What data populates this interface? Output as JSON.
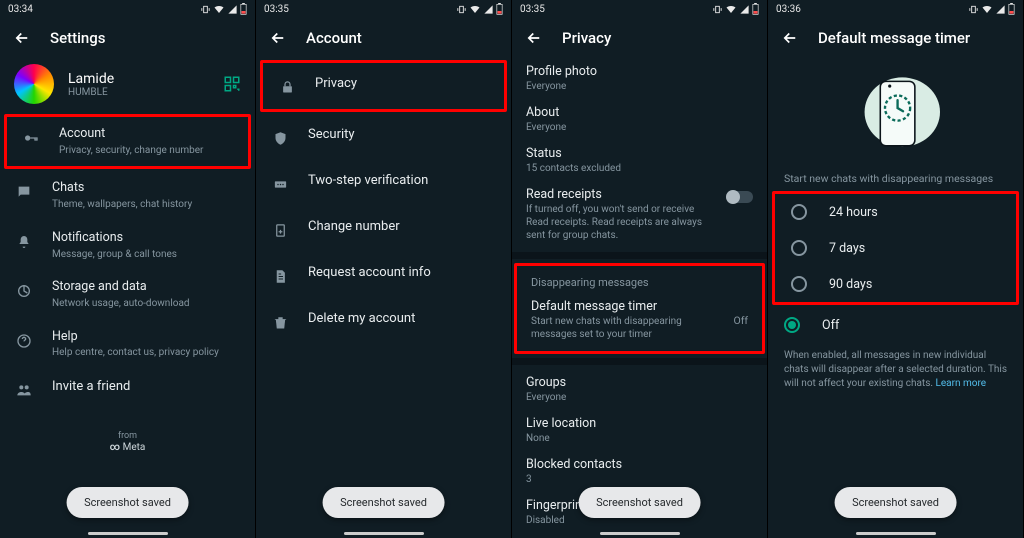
{
  "status": {
    "times": [
      "03:34",
      "03:35",
      "03:35",
      "03:36"
    ]
  },
  "toast": "Screenshot saved",
  "screen1": {
    "title": "Settings",
    "profile": {
      "name": "Lamide",
      "sub": "HUMBLE"
    },
    "items": [
      {
        "title": "Account",
        "sub": "Privacy, security, change number"
      },
      {
        "title": "Chats",
        "sub": "Theme, wallpapers, chat history"
      },
      {
        "title": "Notifications",
        "sub": "Message, group & call tones"
      },
      {
        "title": "Storage and data",
        "sub": "Network usage, auto-download"
      },
      {
        "title": "Help",
        "sub": "Help centre, contact us, privacy policy"
      },
      {
        "title": "Invite a friend",
        "sub": ""
      }
    ],
    "from": "from",
    "meta": "Meta"
  },
  "screen2": {
    "title": "Account",
    "items": [
      {
        "title": "Privacy"
      },
      {
        "title": "Security"
      },
      {
        "title": "Two-step verification"
      },
      {
        "title": "Change number"
      },
      {
        "title": "Request account info"
      },
      {
        "title": "Delete my account"
      }
    ]
  },
  "screen3": {
    "title": "Privacy",
    "items_top": [
      {
        "title": "Profile photo",
        "sub": "Everyone"
      },
      {
        "title": "About",
        "sub": "Everyone"
      },
      {
        "title": "Status",
        "sub": "15 contacts excluded"
      }
    ],
    "read_receipts": {
      "title": "Read receipts",
      "sub": "If turned off, you won't send or receive Read receipts. Read receipts are always sent for group chats."
    },
    "disappearing_header": "Disappearing messages",
    "default_timer": {
      "title": "Default message timer",
      "sub": "Start new chats with disappearing messages set to your timer",
      "value": "Off"
    },
    "items_bottom": [
      {
        "title": "Groups",
        "sub": "Everyone"
      },
      {
        "title": "Live location",
        "sub": "None"
      },
      {
        "title": "Blocked contacts",
        "sub": "3"
      },
      {
        "title": "Fingerprint lock",
        "sub": "Disabled"
      }
    ]
  },
  "screen4": {
    "title": "Default message timer",
    "caption": "Start new chats with disappearing messages",
    "options": [
      "24 hours",
      "7 days",
      "90 days",
      "Off"
    ],
    "selected": 3,
    "note": "When enabled, all messages in new individual chats will disappear after a selected duration. This will not affect your existing chats. ",
    "learn_more": "Learn more"
  }
}
